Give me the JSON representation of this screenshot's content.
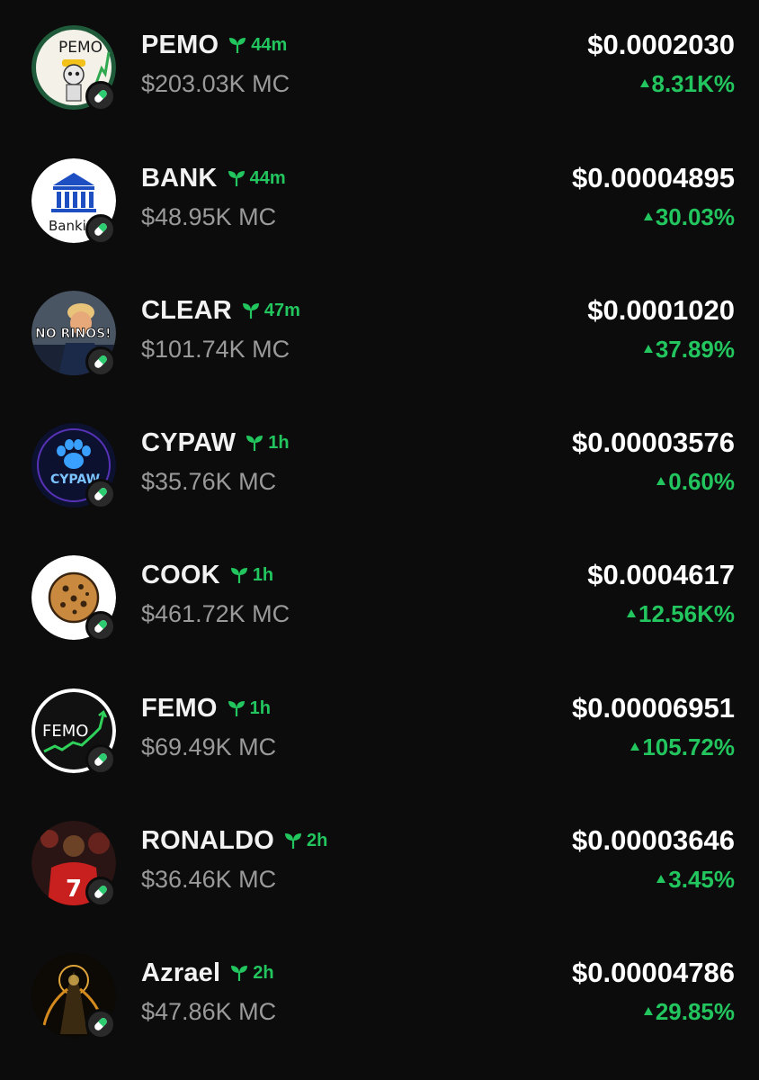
{
  "colors": {
    "background": "#0c0c0c",
    "positive": "#22c55e",
    "muted": "#9a9a9a"
  },
  "tokens": [
    {
      "name": "PEMO",
      "age": "44m",
      "market_cap": "$203.03K MC",
      "price": "$0.0002030",
      "change": "8.31K%",
      "avatar_icon": "pemo-meme-avatar-icon",
      "logo_text": "PEMO"
    },
    {
      "name": "BANK",
      "age": "44m",
      "market_cap": "$48.95K MC",
      "price": "$0.00004895",
      "change": "30.03%",
      "avatar_icon": "bank-building-avatar-icon",
      "logo_text": "Bankin"
    },
    {
      "name": "CLEAR",
      "age": "47m",
      "market_cap": "$101.74K MC",
      "price": "$0.0001020",
      "change": "37.89%",
      "avatar_icon": "politician-avatar-icon",
      "logo_text": "NO RINOS!"
    },
    {
      "name": "CYPAW",
      "age": "1h",
      "market_cap": "$35.76K MC",
      "price": "$0.00003576",
      "change": "0.60%",
      "avatar_icon": "paw-avatar-icon",
      "logo_text": "CYPAW"
    },
    {
      "name": "COOK",
      "age": "1h",
      "market_cap": "$461.72K MC",
      "price": "$0.0004617",
      "change": "12.56K%",
      "avatar_icon": "cookie-avatar-icon"
    },
    {
      "name": "FEMO",
      "age": "1h",
      "market_cap": "$69.49K MC",
      "price": "$0.00006951",
      "change": "105.72%",
      "avatar_icon": "femo-chart-avatar-icon",
      "logo_text": "FEMO"
    },
    {
      "name": "RONALDO",
      "age": "2h",
      "market_cap": "$36.46K MC",
      "price": "$0.00003646",
      "change": "3.45%",
      "avatar_icon": "footballer-avatar-icon",
      "logo_text": "7"
    },
    {
      "name": "Azrael",
      "age": "2h",
      "market_cap": "$47.86K MC",
      "price": "$0.00004786",
      "change": "29.85%",
      "avatar_icon": "angel-avatar-icon"
    }
  ]
}
